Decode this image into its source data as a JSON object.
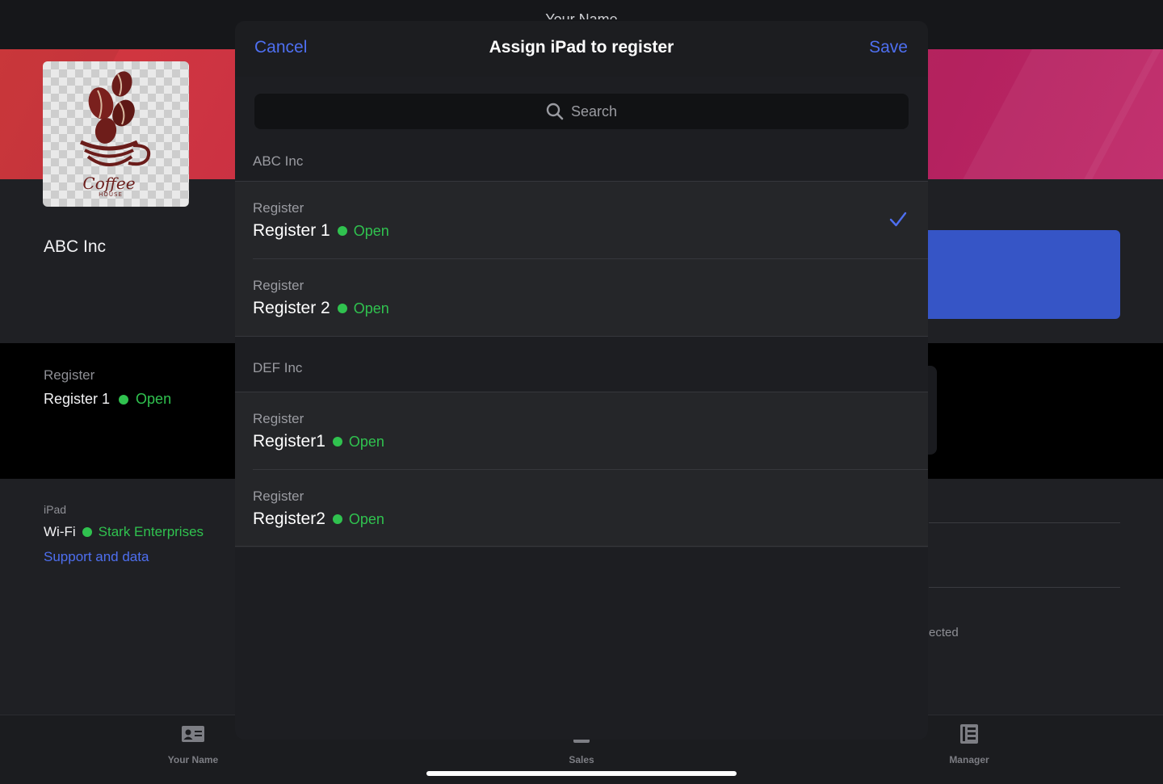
{
  "background": {
    "topbar_title": "Your Name",
    "company_name": "ABC Inc",
    "register_label": "Register",
    "register_name": "Register 1",
    "register_status": "Open",
    "ipad_label": "iPad",
    "wifi_label": "Wi-Fi",
    "wifi_network": "Stark Enterprises",
    "support_link": "Support and data",
    "partial_text": "ected",
    "logo_text": "Coffee",
    "logo_subtext": "HOUSE"
  },
  "modal": {
    "title": "Assign iPad to register",
    "cancel_label": "Cancel",
    "save_label": "Save",
    "search_placeholder": "Search",
    "groups": [
      {
        "name": "ABC Inc",
        "registers": [
          {
            "label": "Register",
            "name": "Register 1",
            "status": "Open",
            "selected": true
          },
          {
            "label": "Register",
            "name": "Register 2",
            "status": "Open",
            "selected": false
          }
        ]
      },
      {
        "name": "DEF Inc",
        "registers": [
          {
            "label": "Register",
            "name": "Register1",
            "status": "Open",
            "selected": false
          },
          {
            "label": "Register",
            "name": "Register2",
            "status": "Open",
            "selected": false
          }
        ]
      }
    ]
  },
  "tabbar": {
    "tabs": [
      {
        "label": "Your Name",
        "icon": "contact-card-icon"
      },
      {
        "label": "Sales",
        "icon": "sales-icon"
      },
      {
        "label": "Manager",
        "icon": "manager-icon"
      }
    ]
  },
  "colors": {
    "accent": "#4e6ff0",
    "status_open": "#30c24f",
    "hero_start": "#d43a3e",
    "hero_end": "#c02668"
  }
}
